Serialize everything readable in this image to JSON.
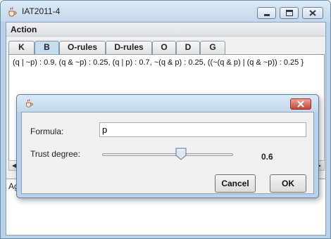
{
  "window": {
    "title": "IAT2011-4"
  },
  "menu": {
    "items": [
      "Action"
    ]
  },
  "tabs": [
    {
      "label": "K",
      "selected": false
    },
    {
      "label": "B",
      "selected": true
    },
    {
      "label": "O-rules",
      "selected": false
    },
    {
      "label": "D-rules",
      "selected": false
    },
    {
      "label": "O",
      "selected": false
    },
    {
      "label": "D",
      "selected": false
    },
    {
      "label": "G",
      "selected": false
    }
  ],
  "content": {
    "rules_text": "(q | ~p) : 0.9, (q & ~p) : 0.25, (q | p) : 0.7, ~(q & p) : 0.25, ((~(q & p) | (q & ~p)) : 0.25 }"
  },
  "log": {
    "text": "Ag"
  },
  "dialog": {
    "formula_label": "Formula:",
    "formula_value": "p",
    "trust_label": "Trust degree:",
    "trust_value": "0.6",
    "trust_level": 0.6,
    "cancel_label": "Cancel",
    "ok_label": "OK"
  },
  "icons": {
    "app": "java-coffee-cup-icon",
    "minimize": "minimize-icon",
    "maximize": "maximize-icon",
    "close": "close-icon"
  },
  "colors": {
    "window_frame": "#b9d1ea",
    "selected_tab": "#c8dcf0",
    "close_button": "#c2473a"
  }
}
